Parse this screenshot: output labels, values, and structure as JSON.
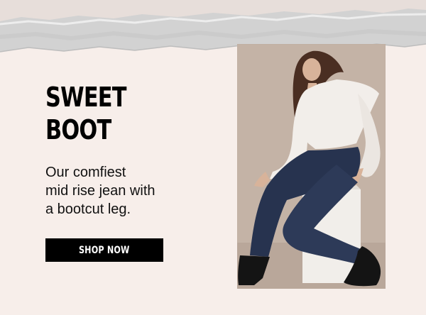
{
  "headline": {
    "line1": "SWEET",
    "line2": "BOOT"
  },
  "body_copy": {
    "line1": "Our comfiest",
    "line2": "mid rise jean with",
    "line3": "a bootcut leg."
  },
  "cta": {
    "label": "SHOP NOW"
  },
  "colors": {
    "background": "#f7eeea",
    "cta_background": "#000000",
    "cta_text": "#ffffff",
    "denim": "#26324f"
  }
}
